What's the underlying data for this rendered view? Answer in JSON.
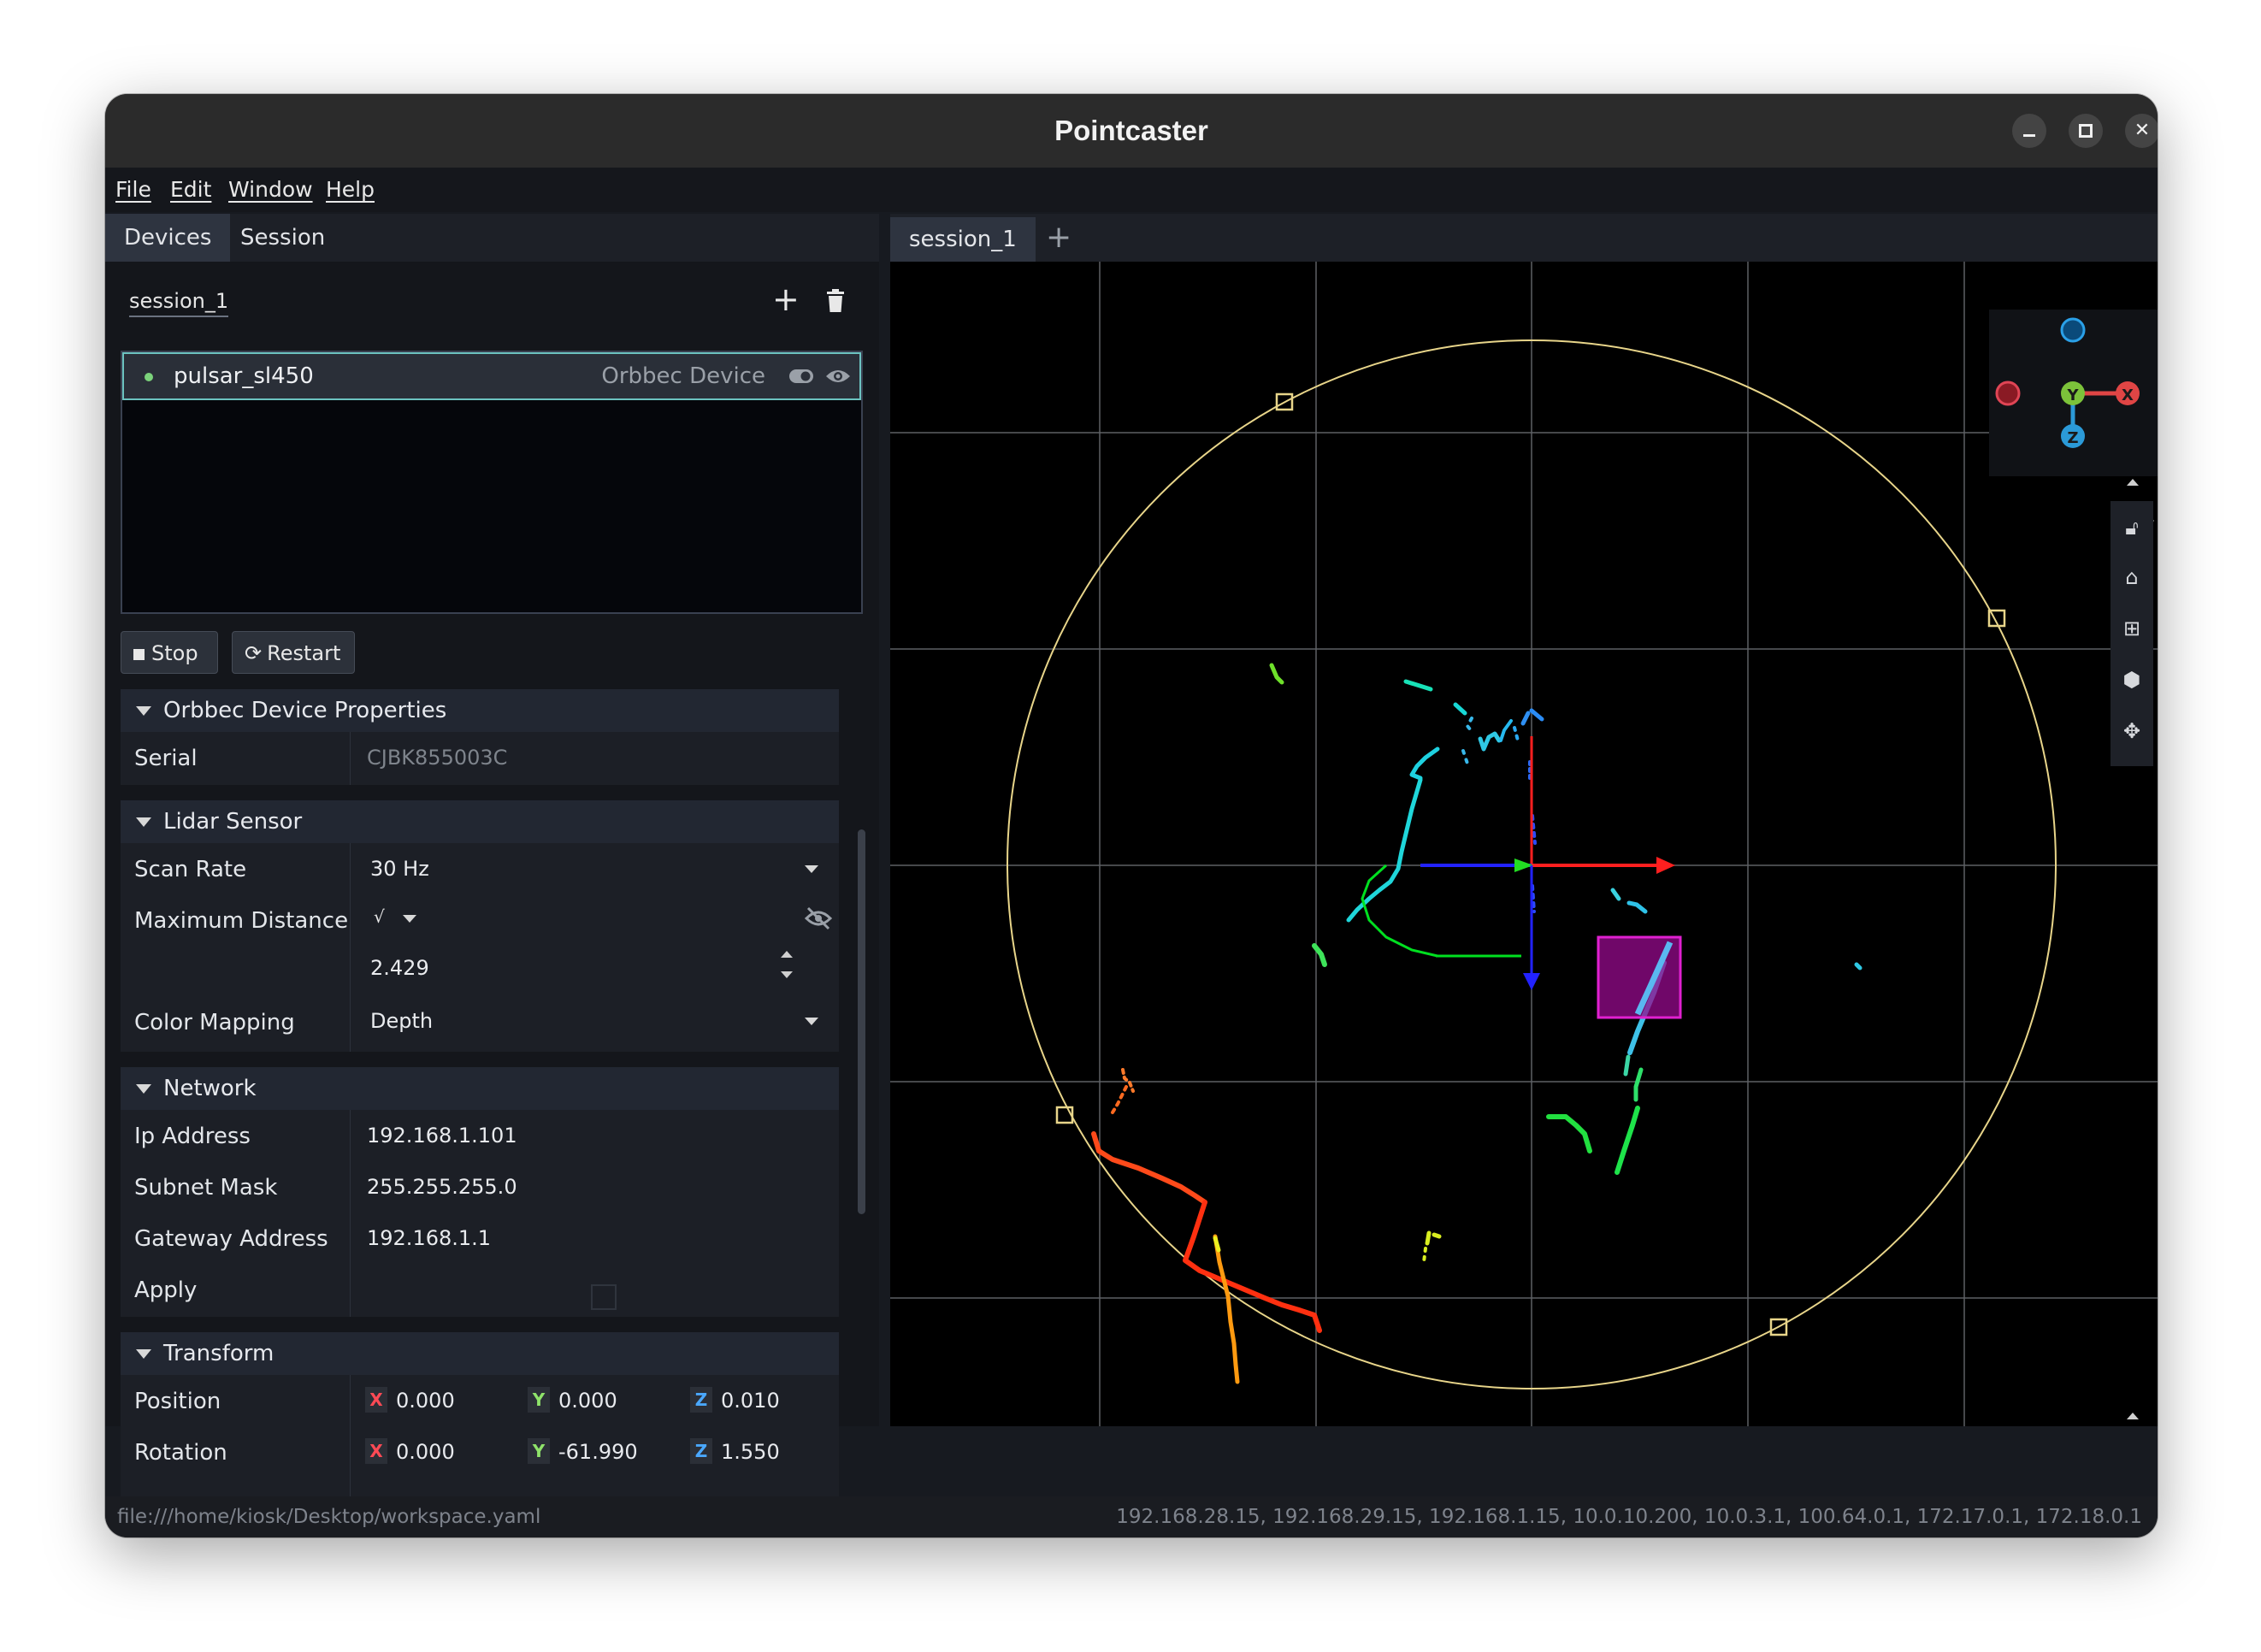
{
  "window": {
    "title": "Pointcaster"
  },
  "menu": {
    "items": [
      "File",
      "Edit",
      "Window",
      "Help"
    ]
  },
  "left_panel": {
    "tabs": [
      "Devices",
      "Session"
    ],
    "session_name": "session_1",
    "devices": [
      {
        "name": "pulsar_sl450",
        "type": "Orbbec Device"
      }
    ],
    "buttons": {
      "stop": "Stop",
      "restart": "Restart"
    },
    "properties": {
      "device_section": {
        "title": "Orbbec Device Properties",
        "serial_label": "Serial",
        "serial_value": "CJBK855003C"
      },
      "lidar_section": {
        "title": "Lidar Sensor",
        "scan_rate_label": "Scan Rate",
        "scan_rate_value": "30 Hz",
        "max_distance_label": "Maximum Distance",
        "max_distance_check": "√",
        "max_distance_value": "2.429",
        "color_mapping_label": "Color Mapping",
        "color_mapping_value": "Depth"
      },
      "network_section": {
        "title": "Network",
        "ip_label": "Ip Address",
        "ip_value": "192.168.1.101",
        "subnet_label": "Subnet Mask",
        "subnet_value": "255.255.255.0",
        "gateway_label": "Gateway Address",
        "gateway_value": "192.168.1.1",
        "apply_label": "Apply"
      },
      "transform_section": {
        "title": "Transform",
        "position_label": "Position",
        "position": {
          "x": "0.000",
          "y": "0.000",
          "z": "0.010"
        },
        "rotation_label": "Rotation",
        "rotation": {
          "x": "0.000",
          "y": "-61.990",
          "z": "1.550"
        },
        "axis_letters": {
          "x": "X",
          "y": "Y",
          "z": "Z"
        }
      }
    }
  },
  "viewport": {
    "tabs": [
      "session_1"
    ],
    "add_tab": "+",
    "gizmo_labels": {
      "x": "X",
      "y": "Y",
      "z": "Z"
    },
    "colors": {
      "x_axis": "#ff1f1f",
      "y_axis": "#22dd22",
      "z_axis": "#2222ff",
      "boundary": "#e8d58a",
      "selection": "#e020d0"
    }
  },
  "status_bar": {
    "path": "file:///home/kiosk/Desktop/workspace.yaml",
    "addresses": "192.168.28.15, 192.168.29.15, 192.168.1.15, 10.0.10.200, 10.0.3.1, 100.64.0.1, 172.17.0.1, 172.18.0.1"
  }
}
